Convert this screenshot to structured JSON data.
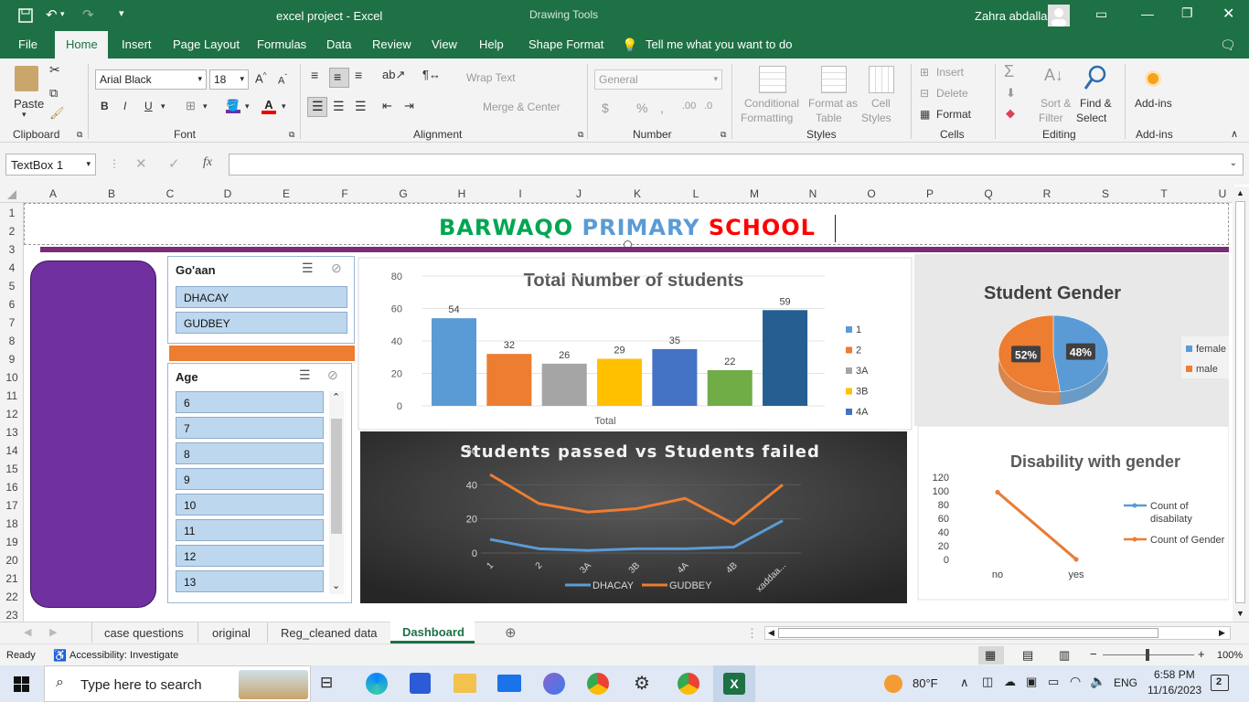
{
  "titlebar": {
    "file_title": "excel project  -  Excel",
    "tools_label": "Drawing Tools",
    "user": "Zahra abdalla"
  },
  "tabs": [
    "File",
    "Home",
    "Insert",
    "Page Layout",
    "Formulas",
    "Data",
    "Review",
    "View",
    "Help",
    "Shape Format"
  ],
  "tell_me": "Tell me what you want to do",
  "ribbon": {
    "clipboard": {
      "paste": "Paste",
      "group": "Clipboard"
    },
    "font": {
      "name": "Arial Black",
      "size": "18",
      "group": "Font"
    },
    "alignment": {
      "wrap": "Wrap Text",
      "merge": "Merge & Center",
      "group": "Alignment"
    },
    "number": {
      "format": "General",
      "group": "Number"
    },
    "styles": {
      "cond1": "Conditional",
      "cond2": "Formatting",
      "fmt1": "Format as",
      "fmt2": "Table",
      "cell1": "Cell",
      "cell2": "Styles",
      "group": "Styles"
    },
    "cells": {
      "insert": "Insert",
      "delete": "Delete",
      "format": "Format",
      "group": "Cells"
    },
    "editing": {
      "sort1": "Sort &",
      "sort2": "Filter",
      "find1": "Find &",
      "find2": "Select",
      "group": "Editing"
    },
    "addins": {
      "label": "Add-ins",
      "group": "Add-ins"
    }
  },
  "formula": {
    "name_box": "TextBox 1",
    "fx": "fx"
  },
  "columns": [
    "A",
    "B",
    "C",
    "D",
    "E",
    "F",
    "G",
    "H",
    "I",
    "J",
    "K",
    "L",
    "M",
    "N",
    "O",
    "P",
    "Q",
    "R",
    "S",
    "T",
    "U"
  ],
  "rows": [
    "1",
    "2",
    "3",
    "4",
    "5",
    "6",
    "7",
    "8",
    "9",
    "10",
    "11",
    "12",
    "13",
    "14",
    "15",
    "16",
    "17",
    "18",
    "19",
    "20",
    "21",
    "22",
    "23"
  ],
  "banner": {
    "w1": "BARWAQO",
    "w2": "PRIMARY",
    "w3": "SCHOOL"
  },
  "slicer_goaan": {
    "title": "Go'aan",
    "items": [
      "DHACAY",
      "GUDBEY"
    ]
  },
  "slicer_age": {
    "title": "Age",
    "items": [
      "6",
      "7",
      "8",
      "9",
      "10",
      "11",
      "12",
      "13"
    ]
  },
  "colors": {
    "excel_green": "#1e7145",
    "purple": "#7030a0",
    "orange": "#ed7d31",
    "blue": "#5b9bd5"
  },
  "chart_data": [
    {
      "type": "bar",
      "title": "Total Number of students",
      "categories": [
        "Total"
      ],
      "ylim": [
        0,
        80
      ],
      "yticks": [
        "0",
        "20",
        "40",
        "60",
        "80"
      ],
      "series": [
        {
          "name": "1",
          "value": 54,
          "color": "#5b9bd5"
        },
        {
          "name": "2",
          "value": 32,
          "color": "#ed7d31"
        },
        {
          "name": "3A",
          "value": 26,
          "color": "#a5a5a5"
        },
        {
          "name": "3B",
          "value": 29,
          "color": "#ffc000"
        },
        {
          "name": "4A",
          "value": 35,
          "color": "#4472c4"
        },
        {
          "value": 22,
          "color": "#70ad47"
        },
        {
          "value": 59,
          "color": "#255e91"
        }
      ]
    },
    {
      "type": "pie",
      "title": "Student Gender",
      "labels": [
        "female",
        "male"
      ],
      "values": [
        48,
        52
      ],
      "value_labels": [
        "48%",
        "52%"
      ],
      "colors": [
        "#5b9bd5",
        "#ed7d31"
      ],
      "legend": "right"
    },
    {
      "type": "line",
      "title": "Students passed vs Students failed",
      "x": [
        "1",
        "2",
        "3A",
        "3B",
        "4A",
        "4B",
        "xaddaa..."
      ],
      "ylim": [
        0,
        60
      ],
      "yticks": [
        "0",
        "20",
        "40",
        "60"
      ],
      "series": [
        {
          "name": "DHACAY",
          "values": [
            8,
            2.5,
            1.5,
            2.5,
            2.5,
            3.5,
            19
          ],
          "color": "#5b9bd5"
        },
        {
          "name": "GUDBEY",
          "values": [
            46,
            29,
            24,
            26,
            32,
            17,
            40
          ],
          "color": "#ed7d31"
        }
      ]
    },
    {
      "type": "line",
      "title": "Disability with gender",
      "x": [
        "no",
        "yes"
      ],
      "ylim": [
        0,
        120
      ],
      "yticks": [
        "0",
        "20",
        "40",
        "60",
        "80",
        "100",
        "120"
      ],
      "series": [
        {
          "name": "Count of disabilaty",
          "values": [
            98,
            0
          ],
          "color": "#5b9bd5"
        },
        {
          "name": "Count of Gender",
          "values": [
            98,
            0
          ],
          "color": "#ed7d31"
        }
      ]
    }
  ],
  "sheets": [
    "case questions",
    "original",
    "Reg_cleaned data",
    "Dashboard"
  ],
  "status": {
    "ready": "Ready",
    "access": "Accessibility: Investigate",
    "zoom": "100%"
  },
  "taskbar": {
    "search": "Type here to search",
    "temp": "80°F",
    "lang": "ENG",
    "time": "6:58 PM",
    "date": "11/16/2023",
    "notif": "2"
  }
}
